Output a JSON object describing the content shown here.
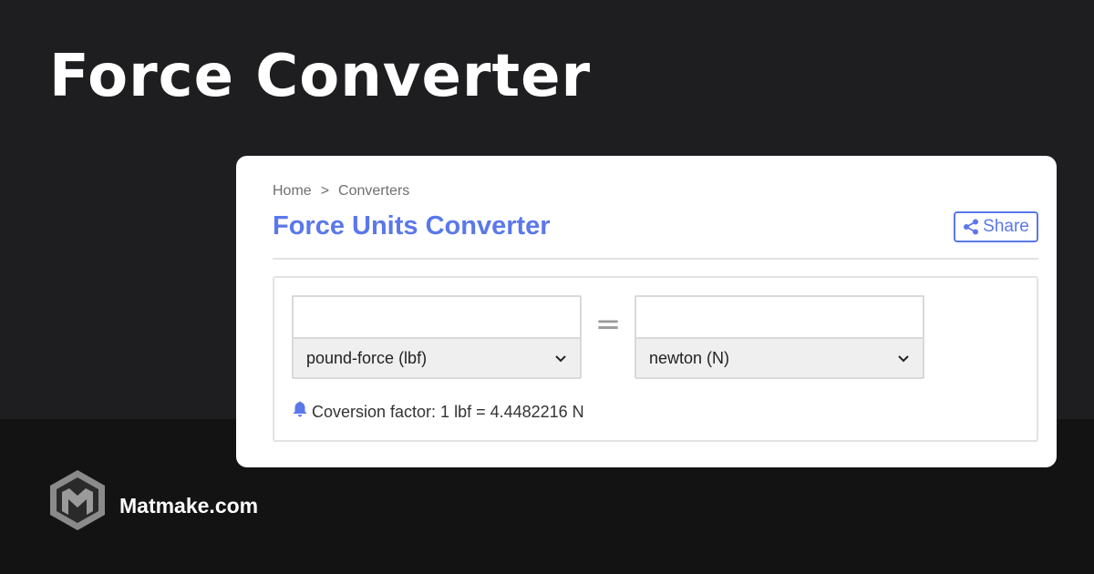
{
  "hero": {
    "title": "Force Converter"
  },
  "card": {
    "breadcrumb": [
      {
        "label": "Home"
      },
      {
        "label": "Converters"
      }
    ],
    "breadcrumb_separator": ">",
    "title": "Force Units Converter",
    "share_label": "Share",
    "converter": {
      "from": {
        "value": "",
        "unit": "pound-force (lbf)"
      },
      "equals": "=",
      "to": {
        "value": "",
        "unit": "newton (N)"
      },
      "factor_text": "Coversion factor: 1 lbf = 4.4482216 N"
    }
  },
  "brand": {
    "name": "Matmake.com"
  },
  "colors": {
    "accent": "#5b78ea",
    "background_top": "#1e1e20",
    "background_bottom": "#131313",
    "card": "#ffffff"
  },
  "icons": {
    "share": "share-icon",
    "bell": "bell-icon",
    "dropdown": "chevron-down-icon",
    "logo": "matmake-logo"
  }
}
